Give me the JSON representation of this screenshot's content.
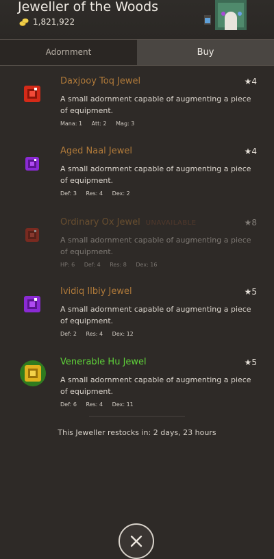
{
  "header": {
    "title": "Jeweller of the Woods",
    "gold": "1,821,922",
    "coin_icon": "gold-coins-icon"
  },
  "tabs": [
    {
      "label": "Adornment",
      "active": false
    },
    {
      "label": "Buy",
      "active": true
    }
  ],
  "items": [
    {
      "name": "Daxjooy Toq Jewel",
      "tier": "★4",
      "unavailable": "",
      "desc": "A small adornment capable of augmenting a piece of equipment.",
      "stats": [
        "Mana: 1",
        "Att: 2",
        "Mag: 3"
      ],
      "name_color": "#b07a3a",
      "gem_color": "#d42a18"
    },
    {
      "name": "Aged Naal Jewel",
      "tier": "★4",
      "unavailable": "",
      "desc": "A small adornment capable of augmenting a piece of equipment.",
      "stats": [
        "Def: 3",
        "Res: 4",
        "Dex: 2"
      ],
      "name_color": "#b07a3a",
      "gem_color": "#8a2ad4"
    },
    {
      "name": "Ordinary Ox Jewel",
      "tier": "★8",
      "unavailable": "UNAVAILABLE",
      "desc": "A small adornment capable of augmenting a piece of equipment.",
      "stats": [
        "HP: 6",
        "Def: 4",
        "Res: 8",
        "Dex: 16"
      ],
      "name_color": "#b07a3a",
      "gem_color": "#d42a18"
    },
    {
      "name": "Ividiq Ilbiy Jewel",
      "tier": "★5",
      "unavailable": "",
      "desc": "A small adornment capable of augmenting a piece of equipment.",
      "stats": [
        "Def: 2",
        "Res: 4",
        "Dex: 12"
      ],
      "name_color": "#b07a3a",
      "gem_color": "#8a2ad4"
    },
    {
      "name": "Venerable Hu Jewel",
      "tier": "★5",
      "unavailable": "",
      "desc": "A small adornment capable of augmenting a piece of equipment.",
      "stats": [
        "Def: 6",
        "Res: 4",
        "Dex: 11"
      ],
      "name_color": "#5fd23a",
      "gem_color": "#e0b21e"
    }
  ],
  "restock": "This Jeweller restocks in: 2 days, 23 hours",
  "close_icon": "close-icon"
}
